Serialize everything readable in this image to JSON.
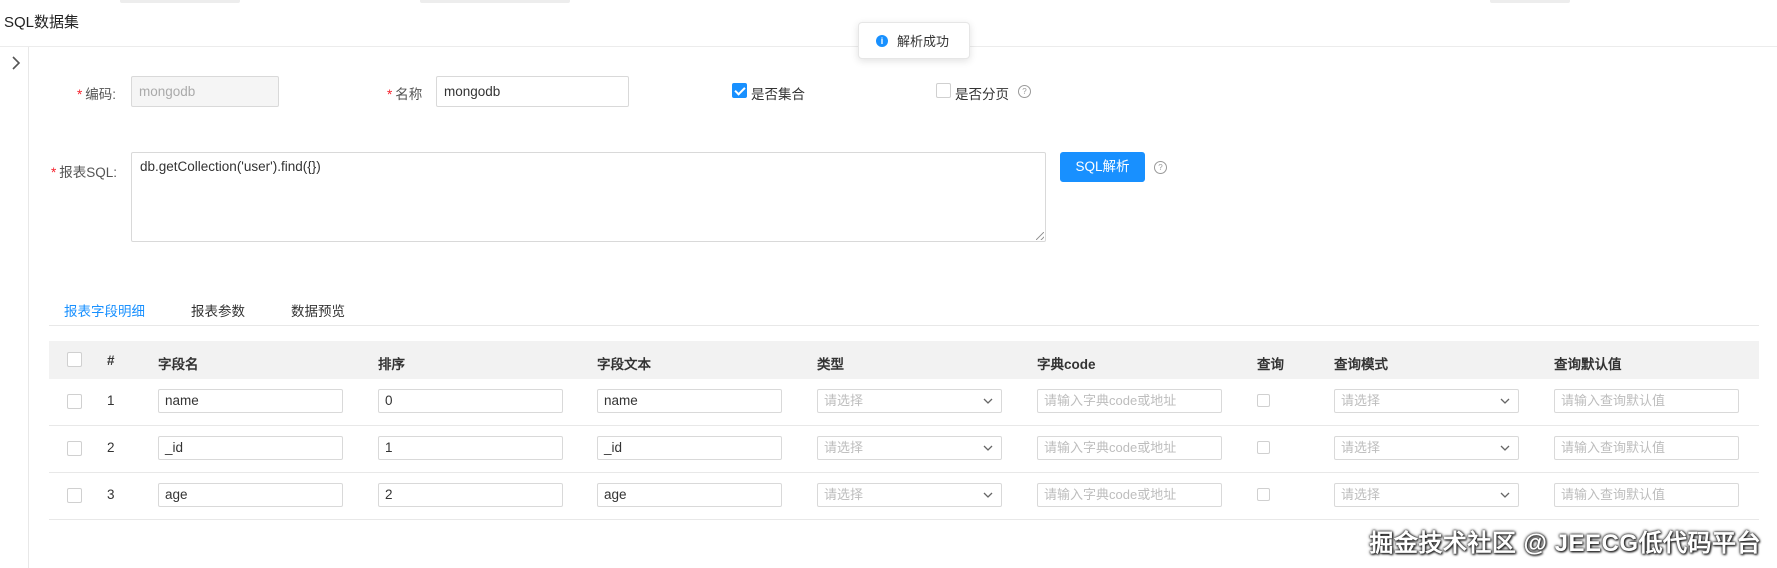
{
  "page": {
    "title": "SQL数据集"
  },
  "toast": {
    "message": "解析成功"
  },
  "form": {
    "code_label": "编码:",
    "code_value": "mongodb",
    "name_label": "名称",
    "name_value": "mongodb",
    "is_collection_label": "是否集合",
    "is_collection_checked": true,
    "is_paged_label": "是否分页",
    "is_paged_checked": false,
    "sql_label": "报表SQL:",
    "sql_value": "db.getCollection('user').find({})",
    "parse_button": "SQL解析",
    "help_glyph": "?"
  },
  "tabs": [
    {
      "label": "报表字段明细",
      "active": true
    },
    {
      "label": "报表参数",
      "active": false
    },
    {
      "label": "数据预览",
      "active": false
    }
  ],
  "table": {
    "headers": {
      "index": "#",
      "field_name": "字段名",
      "order": "排序",
      "field_text": "字段文本",
      "type": "类型",
      "dict_code": "字典code",
      "query": "查询",
      "query_mode": "查询模式",
      "query_default": "查询默认值"
    },
    "placeholders": {
      "type": "请选择",
      "dict_code": "请输入字典code或地址",
      "query_mode": "请选择",
      "query_default": "请输入查询默认值"
    },
    "rows": [
      {
        "index": "1",
        "field_name": "name",
        "order": "0",
        "field_text": "name"
      },
      {
        "index": "2",
        "field_name": "_id",
        "order": "1",
        "field_text": "_id"
      },
      {
        "index": "3",
        "field_name": "age",
        "order": "2",
        "field_text": "age"
      }
    ]
  },
  "watermark": "掘金技术社区 @ JEECG低代码平台",
  "colors": {
    "primary": "#1890ff",
    "required": "#f5222d",
    "header_bg": "#f2f2f2"
  }
}
